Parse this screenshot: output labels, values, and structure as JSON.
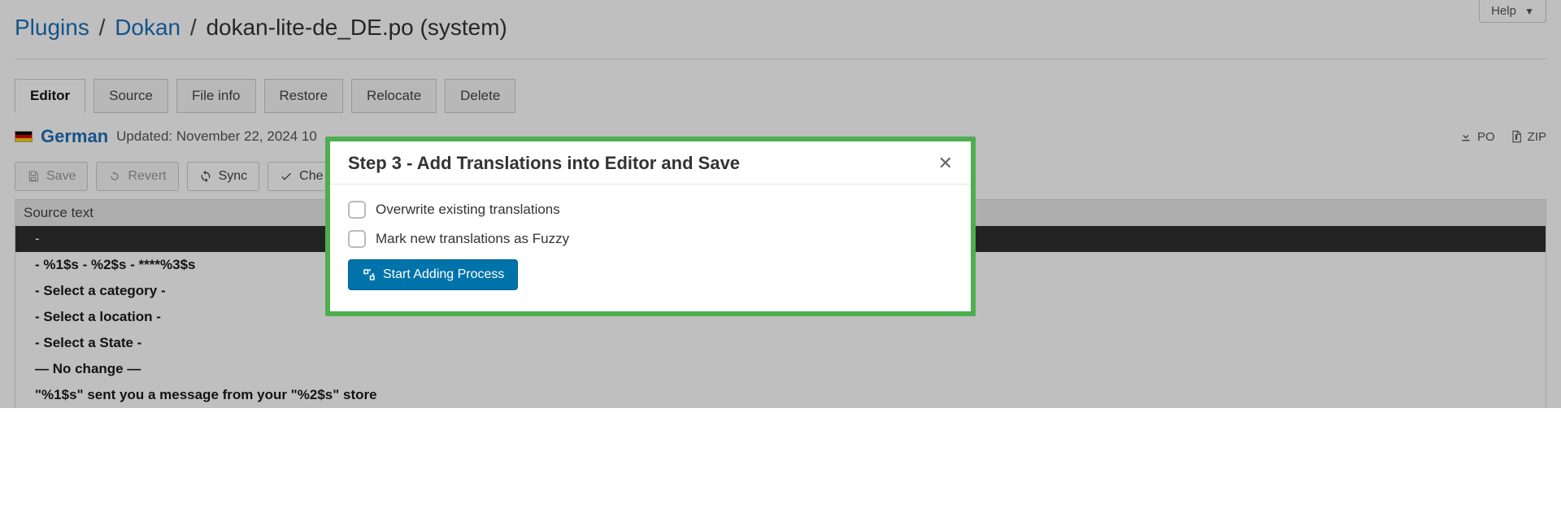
{
  "help_label": "Help",
  "breadcrumbs": {
    "plugins": "Plugins",
    "dokan": "Dokan",
    "file": "dokan-lite-de_DE.po (system)"
  },
  "tabs": {
    "editor": "Editor",
    "source": "Source",
    "fileinfo": "File info",
    "restore": "Restore",
    "relocate": "Relocate",
    "delete": "Delete"
  },
  "language": "German",
  "updated": "Updated: November 22, 2024 10",
  "downloads": {
    "po": "PO",
    "zip": "ZIP"
  },
  "toolbar": {
    "save": "Save",
    "revert": "Revert",
    "sync": "Sync",
    "check_partial": "Che"
  },
  "column_header": "Source text",
  "rows": [
    "-",
    " - %1$s - %2$s - ****%3$s",
    "- Select a category -",
    "- Select a location -",
    "- Select a State -",
    "— No change —",
    "\"%1$s\" sent you a message from your \"%2$s\" store"
  ],
  "modal": {
    "title": "Step 3 - Add Translations into Editor and Save",
    "overwrite": "Overwrite existing translations",
    "fuzzy": "Mark new translations as Fuzzy",
    "start": "Start Adding Process"
  }
}
